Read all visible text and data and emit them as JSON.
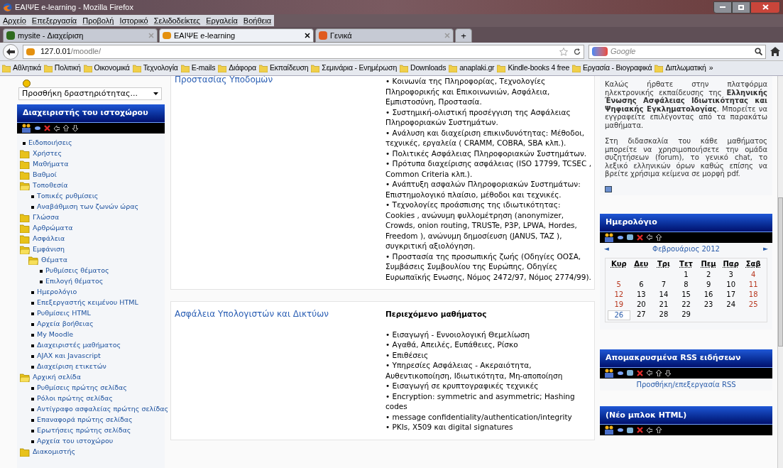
{
  "window": {
    "title": "ΕΑΙΨΕ e-learning - Mozilla Firefox"
  },
  "menu": [
    "Αρχείο",
    "Επεξεργασία",
    "Προβολή",
    "Ιστορικό",
    "Σελιδοδείκτες",
    "Εργαλεία",
    "Βοήθεια"
  ],
  "tabs": [
    {
      "label": "mysite - Διαχείριση",
      "selected": false
    },
    {
      "label": "ΕΑΙΨΕ e-learning",
      "selected": true
    },
    {
      "label": "Γενικά",
      "selected": false
    }
  ],
  "new_tab": "+",
  "address": {
    "host": "127.0.01",
    "path": "/moodle/"
  },
  "search": {
    "placeholder": "Google"
  },
  "bookmarks": [
    "Αθλητικά",
    "Πολιτική",
    "Οικονομικά",
    "Τεχνολογία",
    "E-mails",
    "Διάφορα",
    "Εκπαίδευση",
    "Σεμινάρια - Ενημέρωση",
    "Downloads",
    "anaplaki.gr",
    "Kindle-books 4 free",
    "Εργασία - Βιογραφικά",
    "Διπλωματική"
  ],
  "bookmarks_more": "»",
  "sidebar": {
    "activity_select": "Προσθήκη δραστηριότητας...",
    "admin_block": {
      "title": "Διαχειριστής του ιστοχώρου",
      "items": [
        {
          "kind": "item",
          "label": "Ειδοποιήσεις"
        },
        {
          "kind": "folder",
          "label": "Χρήστες",
          "expanded": false
        },
        {
          "kind": "folder",
          "label": "Μαθήματα",
          "expanded": false
        },
        {
          "kind": "folder",
          "label": "Βαθμοί",
          "expanded": false
        },
        {
          "kind": "folder",
          "label": "Τοποθεσία",
          "expanded": true,
          "children": [
            {
              "kind": "item",
              "label": "Τοπικές ρυθμίσεις"
            },
            {
              "kind": "item",
              "label": "Αναβάθμιση των ζωνών ώρας"
            }
          ]
        },
        {
          "kind": "folder",
          "label": "Γλώσσα",
          "expanded": false
        },
        {
          "kind": "folder",
          "label": "Αρθρώματα",
          "expanded": false
        },
        {
          "kind": "folder",
          "label": "Ασφάλεια",
          "expanded": false
        },
        {
          "kind": "folder",
          "label": "Εμφάνιση",
          "expanded": true,
          "children": [
            {
              "kind": "folder",
              "label": "Θέματα",
              "expanded": true,
              "children": [
                {
                  "kind": "item",
                  "label": "Ρυθμίσεις θέματος"
                },
                {
                  "kind": "item",
                  "label": "Επιλογή θέματος"
                }
              ]
            },
            {
              "kind": "item",
              "label": "Ημερολόγιο"
            },
            {
              "kind": "item",
              "label": "Επεξεργαστής κειμένου HTML"
            },
            {
              "kind": "item",
              "label": "Ρυθμίσεις HTML"
            },
            {
              "kind": "item",
              "label": "Αρχεία βοήθειας"
            },
            {
              "kind": "item",
              "label": "My Moodle"
            },
            {
              "kind": "item",
              "label": "Διαχειριστές μαθήματος"
            },
            {
              "kind": "item",
              "label": "AJAX και Javascript"
            },
            {
              "kind": "item",
              "label": "Διαχείριση ετικετών"
            }
          ]
        },
        {
          "kind": "folder",
          "label": "Αρχική σελίδα",
          "expanded": true,
          "children": [
            {
              "kind": "item",
              "label": "Ρυθμίσεις πρώτης σελίδας"
            },
            {
              "kind": "item",
              "label": "Ρόλοι πρώτης σελίδας"
            },
            {
              "kind": "item",
              "label": "Αντίγραφο ασφαλείας πρώτης σελίδας"
            },
            {
              "kind": "item",
              "label": "Επαναφορά πρώτης σελίδας"
            },
            {
              "kind": "item",
              "label": "Ερωτήσεις πρώτης σελίδας"
            },
            {
              "kind": "item",
              "label": "Αρχεία του ιστοχώρου"
            }
          ]
        },
        {
          "kind": "folder",
          "label": "Διακομιστής",
          "expanded": false
        }
      ]
    }
  },
  "courses": [
    {
      "title": "Προστασίας Υποδομών",
      "lines": [
        "• Κοινωνία της Πληροφορίας, Τεχνολογίες Πληροφορικής και Επικοινωνιών, Ασφάλεια, Εμπιστοσύνη, Προστασία.",
        "• Συστημική-ολιστική προσέγγιση της Ασφάλειας Πληροφοριακών Συστημάτων.",
        "• Ανάλυση και διαχείριση επικινδυνότητας: Μέθοδοι, τεχνικές, εργαλεία ( CRAMM, COBRA, SBA κλπ.).",
        "• Πολιτικές Ασφάλειας Πληροφοριακών Συστημάτων.",
        "• Πρότυπα διαχείρισης ασφάλειας (ISO 17799, TCSEC , Common Criteria κλπ.).",
        "• Ανάπτυξη ασφαλών Πληροφοριακών Συστημάτων: Επιστημολογικό πλαίσιο, μέθοδοι και τεχνικές.",
        "• Τεχνολογίες προάσπισης της ιδιωτικότητας: Cookies , ανώνυμη φυλλομέτρηση (anonymizer, Crowds, onion routing, TRUSTe, P3P, LPWA, Hordes, Freedom ), ανώνυμη δημοσίευση (JANUS, TAZ ), συγκριτική αξιολόγηση.",
        "• Προστασία της προσωπικής ζωής (Οδηγίες ΟΟΣΑ, Συμβάσεις Συμβουλίου της Ευρώπης, Οδηγίες Ευρωπαϊκής Ενωσης, Νόμος 2472/97, Νόμος 2774/99)."
      ]
    },
    {
      "title": "Ασφάλεια Υπολογιστών και Δικτύων",
      "heading": "Περιεχόμενο μαθήματος",
      "lines": [
        "• Εισαγωγή - Εννοιολογική Θεμελίωση",
        "• Αγαθά, Απειλές, Ευπάθειες, Ρίσκο",
        "• Επιθέσεις",
        "• Υπηρεσίες Ασφάλειας - Ακεραιότητα, Αυθεντικοποίηση, Ιδιωτικότητα, Μη-αποποίηση",
        "• Εισαγωγή σε κρυπτογραφικές τεχνικές",
        "• Encryption: symmetric and asymmetric; Hashing codes",
        "• message confidentiality/authentication/integrity",
        "• PKIs, X509 και digital signatures"
      ]
    }
  ],
  "welcome": {
    "paragraphs": [
      "Καλώς ήρθατε στην πλατφόρμα ηλεκτρονικής εκπαίδευσης της **Ελληνικής Ένωσης Ασφάλειας Ιδιωτικότητας και Ψηφιακής Εγκληματολογίας**. Μπορείτε να εγγραφείτε επιλέγοντας από τα παρακάτω μαθήματα.",
      "Στη διδασκαλία του κάθε μαθήματος μπορείτε να χρησιμοποιήσετε την ομάδα συζητήσεων (forum), το γενικό chat, το λεξικό ελληνικών όρων καθώς επίσης να βρείτε χρήσιμα κείμενα σε μορφή pdf."
    ]
  },
  "calendar": {
    "title": "Ημερολόγιο",
    "month": "Φεβρουάριος 2012",
    "prev": "◄",
    "next": "►",
    "weekdays": [
      "Κυρ",
      "Δευ",
      "Τρι",
      "Τετ",
      "Πεμ",
      "Παρ",
      "Σαβ"
    ],
    "weeks": [
      [
        {
          "day": "1",
          "today": false
        },
        {
          "day": "2",
          "today": false
        },
        {
          "day": "3",
          "today": false
        },
        {
          "day": "4",
          "today": false
        }
      ],
      [
        {
          "day": "5",
          "today": false
        },
        {
          "day": "6",
          "today": false
        },
        {
          "day": "7",
          "today": false
        },
        {
          "day": "8",
          "today": false
        },
        {
          "day": "9",
          "today": false
        },
        {
          "day": "10",
          "today": false
        },
        {
          "day": "11",
          "today": false
        }
      ],
      [
        {
          "day": "12",
          "today": false
        },
        {
          "day": "13",
          "today": false
        },
        {
          "day": "14",
          "today": false
        },
        {
          "day": "15",
          "today": false
        },
        {
          "day": "16",
          "today": false
        },
        {
          "day": "17",
          "today": false
        },
        {
          "day": "18",
          "today": false
        }
      ],
      [
        {
          "day": "19",
          "today": false
        },
        {
          "day": "20",
          "today": false
        },
        {
          "day": "21",
          "today": false
        },
        {
          "day": "22",
          "today": false
        },
        {
          "day": "23",
          "today": false
        },
        {
          "day": "24",
          "today": false
        },
        {
          "day": "25",
          "today": false
        }
      ],
      [
        {
          "day": "26",
          "today": true
        },
        {
          "day": "27",
          "today": false
        },
        {
          "day": "28",
          "today": false
        },
        {
          "day": "29",
          "today": false
        }
      ]
    ]
  },
  "rss": {
    "title": "Απομακρυσμένα RSS ειδήσεων",
    "link": "Προσθήκη/επεξεργασία RSS"
  },
  "html_block": {
    "title": "(Νέο μπλοκ HTML)"
  }
}
